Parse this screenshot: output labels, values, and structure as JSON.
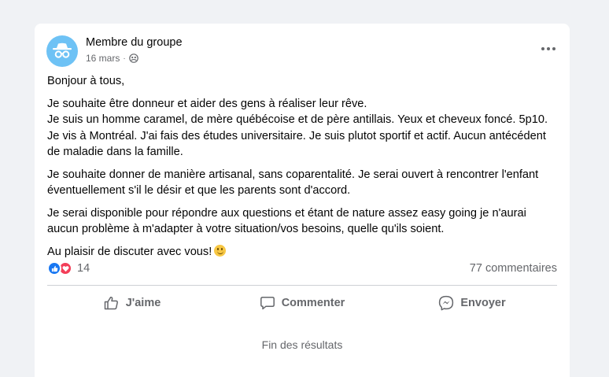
{
  "post": {
    "author": "Membre du groupe",
    "date": "16 mars",
    "separator": "·",
    "avatar_icon": "anonymous-member-icon",
    "more_icon": "more-options-icon",
    "paragraphs": [
      [
        "Bonjour à tous,"
      ],
      [
        "Je souhaite être donneur et aider des gens à réaliser leur rêve.",
        "Je suis un homme caramel, de mère québécoise et de père antillais. Yeux et cheveux foncé. 5p10.",
        "Je vis à Montréal. J'ai fais des études universitaire. Je suis plutot sportif et actif. Aucun antécédent",
        "de maladie dans la famille."
      ],
      [
        "Je souhaite donner de manière artisanal, sans coparentalité. Je serai ouvert à rencontrer l'enfant",
        "éventuellement s'il le désir et que les parents sont d'accord."
      ],
      [
        "Je serai disponible pour répondre aux questions et étant de nature assez easy going je n'aurai",
        "aucun problème à m'adapter à votre situation/vos besoins, quelle qu'ils soient."
      ],
      [
        "Au plaisir de discuter avec vous!"
      ]
    ]
  },
  "stats": {
    "reaction_count": "14",
    "comments": "77 commentaires"
  },
  "actions": {
    "like": "J'aime",
    "comment": "Commenter",
    "send": "Envoyer"
  },
  "footer": {
    "end_text": "Fin des résultats"
  },
  "colors": {
    "background": "#f0f2f5",
    "card": "#ffffff",
    "secondary_text": "#65676b",
    "like_blue": "#1877f2",
    "love_red": "#f33e58",
    "avatar_blue": "#6ec2f5"
  }
}
